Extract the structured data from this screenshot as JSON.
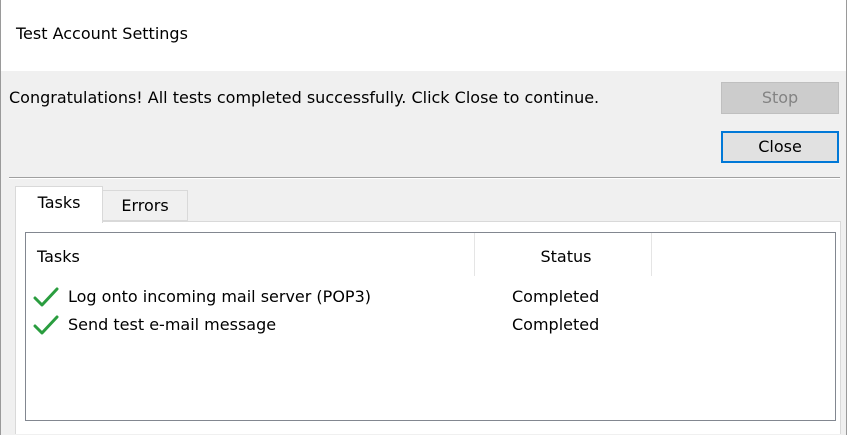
{
  "window": {
    "title": "Test Account Settings"
  },
  "message": "Congratulations! All tests completed successfully. Click Close to continue.",
  "buttons": {
    "stop_label": "Stop",
    "close_label": "Close"
  },
  "tabs": [
    {
      "label": "Tasks",
      "selected": true
    },
    {
      "label": "Errors",
      "selected": false
    }
  ],
  "table": {
    "columns": [
      "Tasks",
      "Status"
    ],
    "rows": [
      {
        "task": "Log onto incoming mail server (POP3)",
        "status": "Completed",
        "icon": "green-checkmark-icon"
      },
      {
        "task": "Send test e-mail message",
        "status": "Completed",
        "icon": "green-checkmark-icon"
      }
    ]
  },
  "colors": {
    "accent": "#0078d7",
    "check": "#2a9d3f",
    "dialog_background": "#f0f0f0"
  }
}
